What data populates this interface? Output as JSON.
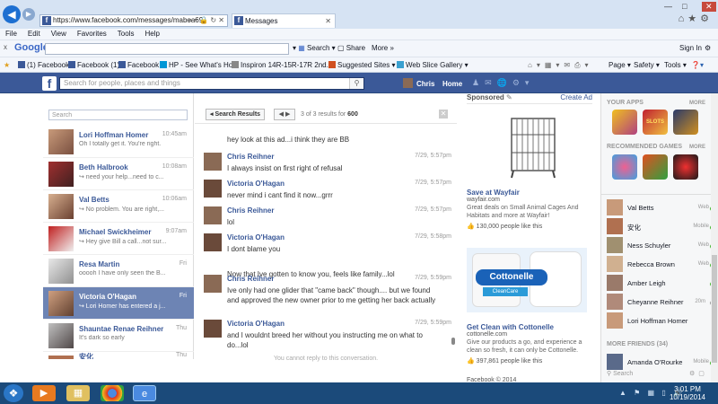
{
  "browser": {
    "url": "https://www.facebook.com/messages/mabea69",
    "tab_title": "Messages",
    "menu": [
      "File",
      "Edit",
      "View",
      "Favorites",
      "Tools",
      "Help"
    ],
    "google_bar": {
      "logo": "Google",
      "search": "Search",
      "share": "Share",
      "more": "More »",
      "signin": "Sign In"
    },
    "favorites": [
      "(1) Facebook",
      "Facebook (1)",
      "Facebook",
      "HP - See What's Hot",
      "Inspiron 14R-15R-17R 2nd...",
      "Suggested Sites",
      "Web Slice Gallery"
    ],
    "command": [
      "Page",
      "Safety",
      "Tools"
    ]
  },
  "fb": {
    "search_placeholder": "Search for people, places and things",
    "user": "Chris",
    "home": "Home"
  },
  "threads": {
    "search_placeholder": "Search",
    "items": [
      {
        "name": "Lori Hoffman Homer",
        "time": "10:45am",
        "snippet": "Oh I totally get it. You're right."
      },
      {
        "name": "Beth Halbrook",
        "time": "10:08am",
        "snippet": "↪ need your help...need to c..."
      },
      {
        "name": "Val Betts",
        "time": "10:06am",
        "snippet": "↪ No problem. You are right,..."
      },
      {
        "name": "Michael Swickheimer",
        "time": "9:07am",
        "snippet": "↪ Hey give Bill a call...not sur..."
      },
      {
        "name": "Resa Martin",
        "time": "Fri",
        "snippet": "ooooh I have only seen the B..."
      },
      {
        "name": "Victoria O'Hagan",
        "time": "Fri",
        "snippet": "↪ Lori Homer has entered a j..."
      },
      {
        "name": "Shauntae Renae Reihner",
        "time": "Thu",
        "snippet": "It's dark so early"
      },
      {
        "name": "安化",
        "time": "Thu",
        "snippet": ""
      }
    ]
  },
  "conversation": {
    "back": "◂ Search Results",
    "result_prefix": "3 of 3 results for",
    "result_query": "600",
    "messages": [
      {
        "name": "",
        "time": "",
        "text": "hey look at this ad...i think they are BB"
      },
      {
        "name": "Chris Reihner",
        "time": "7/29, 5:57pm",
        "text": "I always insist on first right of refusal"
      },
      {
        "name": "Victoria O'Hagan",
        "time": "7/29, 5:57pm",
        "text": "never mind i cant find it now...grrr"
      },
      {
        "name": "Chris Reihner",
        "time": "7/29, 5:57pm",
        "text": "lol"
      },
      {
        "name": "Victoria O'Hagan",
        "time": "7/29, 5:58pm",
        "text": "I dont blame you"
      },
      {
        "name": "",
        "time": "",
        "text": "Now that Ive gotten to know you, feels like family...lol"
      },
      {
        "name": "Chris Reihner",
        "time": "7/29, 5:59pm",
        "text": "Ive only had one glider that \"came back\" though.... but we found and approved the new owner prior to me getting her back actually"
      },
      {
        "name": "Victoria O'Hagan",
        "time": "7/29, 5:59pm",
        "text": "and I wouldnt breed her without you instructing me on what to do...lol"
      }
    ],
    "no_reply": "You cannot reply to this conversation."
  },
  "ads": {
    "sponsored": "Sponsored",
    "create": "Create Ad",
    "items": [
      {
        "title": "Save at Wayfair",
        "url": "wayfair.com",
        "desc": "Great deals on Small Animal Cages And Habitats and more at Wayfair!",
        "likes": "130,000 people like this"
      },
      {
        "title": "Get Clean with Cottonelle",
        "url": "cottonelle.com",
        "desc": "Give our products a go, and experience a clean so fresh, it can only be Cottonelle.",
        "likes": "397,861 people like this",
        "brand": "Cottonelle",
        "sub": "CleanCare"
      }
    ],
    "footer": "Facebook © 2014"
  },
  "chat": {
    "your_apps": "YOUR APPS",
    "recommended": "RECOMMENDED GAMES",
    "more": "MORE",
    "slots": "SLOTS",
    "contacts": [
      {
        "name": "Val Betts",
        "status": "Web"
      },
      {
        "name": "安化",
        "status": "Mobile"
      },
      {
        "name": "Ness Schuyler",
        "status": "Web"
      },
      {
        "name": "Rebecca Brown",
        "status": "Web"
      },
      {
        "name": "Amber Leigh",
        "status": ""
      },
      {
        "name": "Cheyanne Reihner",
        "status": "20m"
      },
      {
        "name": "Lori Hoffman Homer",
        "status": ""
      }
    ],
    "more_friends": "MORE FRIENDS (34)",
    "more_contact": {
      "name": "Amanda O'Rourke",
      "status": "Mobile"
    },
    "search": "Search"
  },
  "taskbar": {
    "time": "3:01 PM",
    "date": "10/19/2014"
  },
  "colors": {
    "fb_blue": "#3b5998",
    "selected": "#6d84b4",
    "online": "#42b72a"
  }
}
